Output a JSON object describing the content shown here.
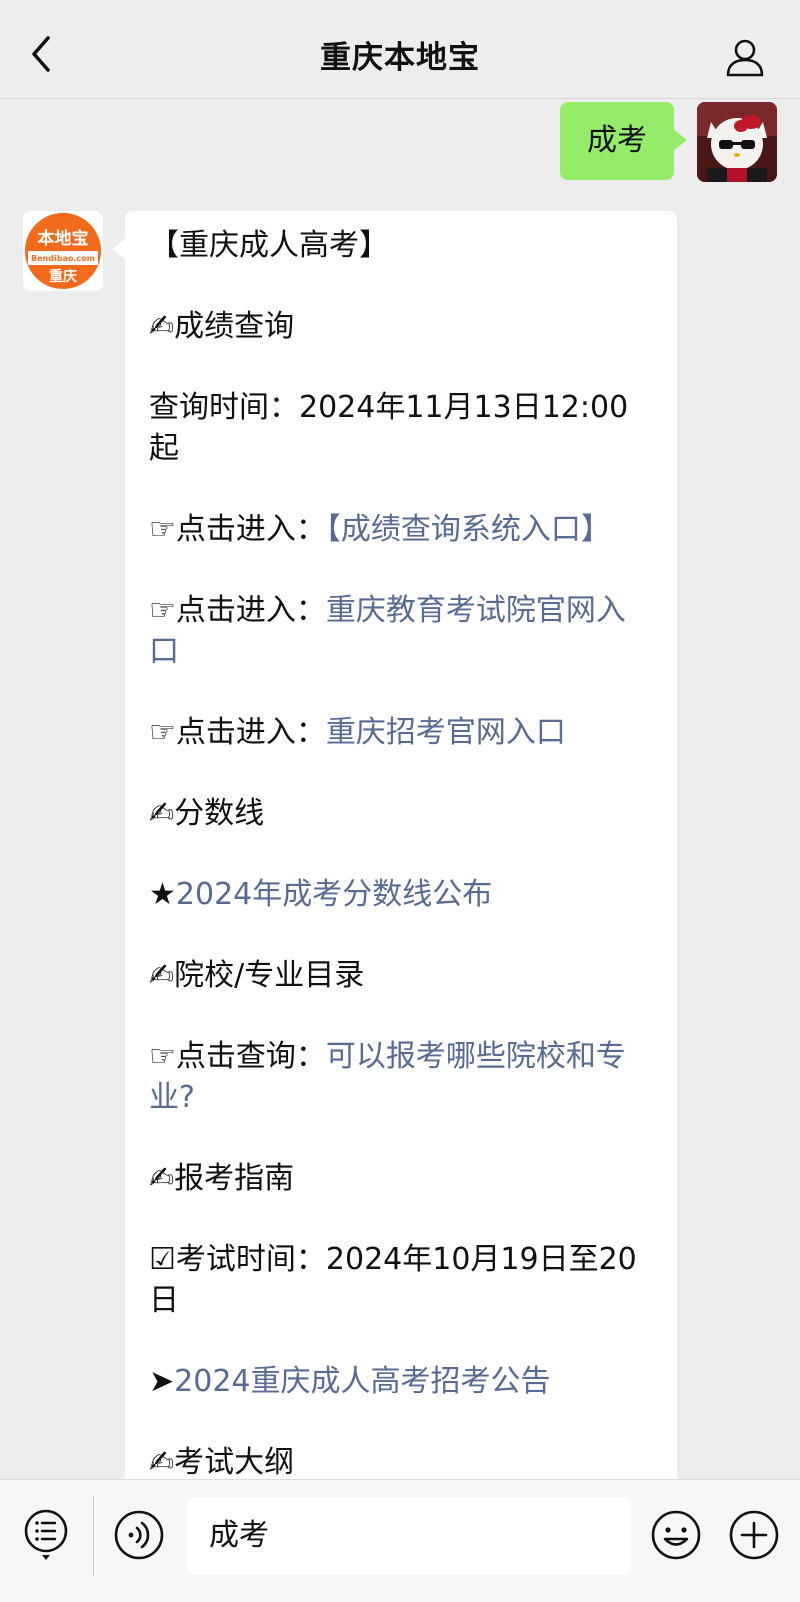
{
  "header": {
    "title": "重庆本地宝"
  },
  "bot": {
    "logo_top": "本地宝",
    "logo_url_text": "Bendibao.com",
    "logo_city": "重庆"
  },
  "user_message": "成考",
  "reply": {
    "heading": "【重庆成人高考】",
    "sec1_title": "✍成绩查询",
    "query_time": "查询时间：2024年11月13日12:00起",
    "entry1_prefix": "☞点击进入：",
    "entry1_link": "【成绩查询系统入口】",
    "entry2_prefix": "☞点击进入：",
    "entry2_link": "重庆教育考试院官网入口",
    "entry3_prefix": "☞点击进入：",
    "entry3_link": "重庆招考官网入口",
    "sec2_title": "✍分数线",
    "score_star": "★",
    "score_link": "2024年成考分数线公布",
    "sec3_title": "✍院校/专业目录",
    "query_prefix": "☞点击查询：",
    "query_link": "可以报考哪些院校和专业?",
    "sec4_title": "✍报考指南",
    "exam_time": "☑考试时间：2024年10月19日至20日",
    "notice_arrow": "➤",
    "notice_link": "2024重庆成人高考招考公告",
    "sec5_title": "✍考试大纲"
  },
  "input": {
    "value": "成考"
  },
  "colors": {
    "background": "#ededed",
    "user_bubble": "#95ec69",
    "bot_bubble": "#ffffff",
    "link": "#576b95",
    "logo_orange": "#f26b1d"
  }
}
